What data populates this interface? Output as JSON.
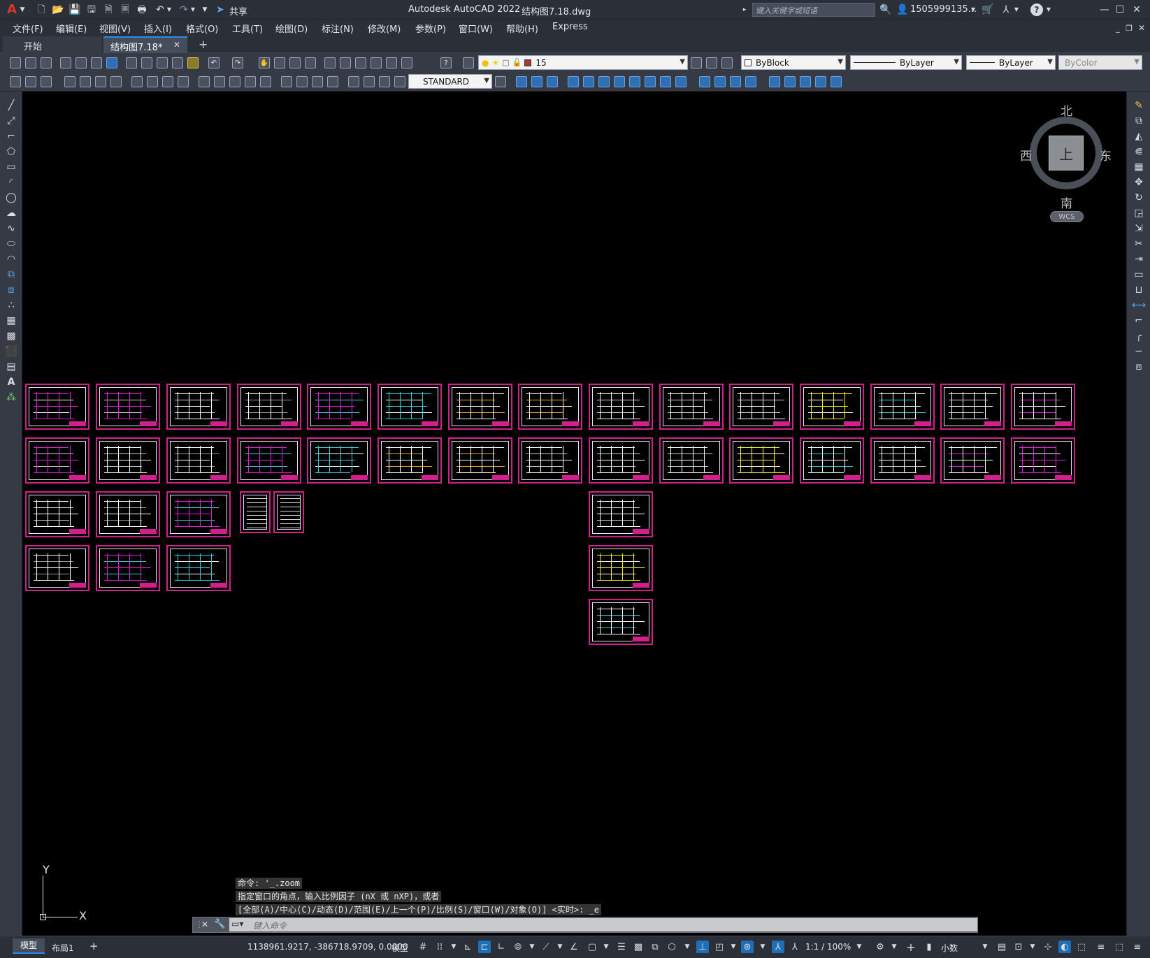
{
  "titlebar": {
    "app_title": "Autodesk AutoCAD 2022",
    "doc_title": "结构图7.18.dwg",
    "share_label": "共享",
    "search_placeholder": "键入关键字或短语",
    "user": "1505999135...",
    "min": "—",
    "max": "☐",
    "close": "✕"
  },
  "menu": {
    "items": [
      "文件(F)",
      "编辑(E)",
      "视图(V)",
      "插入(I)",
      "格式(O)",
      "工具(T)",
      "绘图(D)",
      "标注(N)",
      "修改(M)",
      "参数(P)",
      "窗口(W)",
      "帮助(H)",
      "Express"
    ]
  },
  "tabs": {
    "start": "开始",
    "active": "结构图7.18*",
    "close": "✕",
    "add": "+"
  },
  "toolbar1": {
    "layer_value": "15",
    "color_value": "ByBlock",
    "linetype_value": "ByLayer",
    "lineweight_value": "ByLayer",
    "plotstyle_value": "ByColor"
  },
  "toolbar2": {
    "textstyle_value": "STANDARD"
  },
  "viewcube": {
    "north": "北",
    "south": "南",
    "east": "东",
    "west": "西",
    "face": "上",
    "wcs": "WCS"
  },
  "ucs": {
    "x": "X",
    "y": "Y"
  },
  "command": {
    "history": [
      "命令: '_.zoom",
      "指定窗口的角点，输入比例因子 (nX 或 nXP)，或者",
      "[全部(A)/中心(C)/动态(D)/范围(E)/上一个(P)/比例(S)/窗口(W)/对象(O)] <实时>: _e"
    ],
    "placeholder": "键入命令"
  },
  "status": {
    "model_tab": "模型",
    "layout_tab": "布局1",
    "add_tab": "+",
    "coords": "1138961.9217, -386718.9709, 0.0000",
    "space": "模型",
    "scale": "1:1 / 100%",
    "units": "小数"
  }
}
